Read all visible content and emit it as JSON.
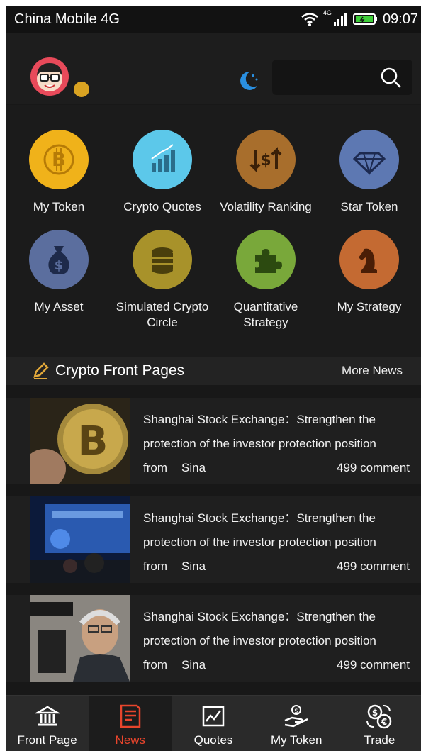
{
  "status_bar": {
    "carrier": "China Mobile 4G",
    "network": "4G",
    "time": "09:07"
  },
  "header": {
    "search": {
      "placeholder": ""
    }
  },
  "colors": {
    "accent": "#e8452c",
    "moon": "#2a8fe0",
    "pencil": "#e2a93a"
  },
  "grid": [
    {
      "label": "My Token",
      "icon": "bitcoin-icon",
      "color": "#f0b21a"
    },
    {
      "label": "Crypto Quotes",
      "icon": "bar-chart-icon",
      "color": "#5cc8ea"
    },
    {
      "label": "Volatility Ranking",
      "icon": "dollar-arrows-icon",
      "color": "#a86e2c"
    },
    {
      "label": "Star Token",
      "icon": "diamond-icon",
      "color": "#5d78b2"
    },
    {
      "label": "My Asset",
      "icon": "money-bag-icon",
      "color": "#5b6e9e"
    },
    {
      "label": "Simulated Crypto Circle",
      "icon": "coin-stack-icon",
      "color": "#a8922a"
    },
    {
      "label": "Quantitative Strategy",
      "icon": "puzzle-icon",
      "color": "#79a83a"
    },
    {
      "label": "My Strategy",
      "icon": "chess-knight-icon",
      "color": "#c46a32"
    }
  ],
  "section": {
    "title": "Crypto Front Pages",
    "more": "More News"
  },
  "news": [
    {
      "title": "Shanghai Stock Exchange：Strengthen the protection of the investor protection position",
      "from_label": "from",
      "source": "Sina",
      "comments": "499 comment"
    },
    {
      "title": "Shanghai Stock Exchange：Strengthen the protection of the investor protection position",
      "from_label": "from",
      "source": "Sina",
      "comments": "499 comment"
    },
    {
      "title": "Shanghai Stock Exchange：Strengthen the protection of the investor protection position",
      "from_label": "from",
      "source": "Sina",
      "comments": "499 comment"
    }
  ],
  "nav": [
    {
      "label": "Front Page",
      "icon": "bank-icon",
      "active": false
    },
    {
      "label": "News",
      "icon": "news-icon",
      "active": true
    },
    {
      "label": "Quotes",
      "icon": "chart-icon",
      "active": false
    },
    {
      "label": "My Token",
      "icon": "coin-hand-icon",
      "active": false
    },
    {
      "label": "Trade",
      "icon": "exchange-icon",
      "active": false
    }
  ]
}
